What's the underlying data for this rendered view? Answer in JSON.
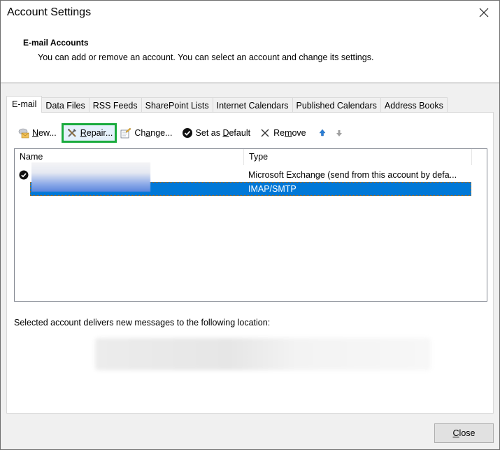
{
  "window": {
    "title": "Account Settings",
    "close_icon": "close-icon"
  },
  "header": {
    "section_title": "E-mail Accounts",
    "description": "You can add or remove an account. You can select an account and change its settings."
  },
  "tabs": [
    {
      "label": "E-mail",
      "active": true
    },
    {
      "label": "Data Files",
      "active": false
    },
    {
      "label": "RSS Feeds",
      "active": false
    },
    {
      "label": "SharePoint Lists",
      "active": false
    },
    {
      "label": "Internet Calendars",
      "active": false
    },
    {
      "label": "Published Calendars",
      "active": false
    },
    {
      "label": "Address Books",
      "active": false
    }
  ],
  "toolbar": {
    "new": {
      "pre": "",
      "accel": "N",
      "post": "ew...",
      "icon": "new-mail-icon"
    },
    "repair": {
      "pre": "",
      "accel": "R",
      "post": "epair...",
      "icon": "repair-tools-icon",
      "highlight_color": "#1aab3d"
    },
    "change": {
      "pre": "Ch",
      "accel": "a",
      "post": "nge...",
      "icon": "change-settings-icon"
    },
    "set_default": {
      "pre": "Set as ",
      "accel": "D",
      "post": "efault",
      "icon": "check-circle-icon"
    },
    "remove": {
      "pre": "Re",
      "accel": "m",
      "post": "ove",
      "icon": "x-icon"
    },
    "move_up_icon": "arrow-up-icon",
    "move_down_icon": "arrow-down-icon"
  },
  "accounts": {
    "columns": [
      "Name",
      "Type"
    ],
    "rows": [
      {
        "name": "",
        "type": "Microsoft Exchange (send from this account by defa...",
        "default": true,
        "selected": false
      },
      {
        "name": "",
        "type": "IMAP/SMTP",
        "default": false,
        "selected": true
      }
    ]
  },
  "delivery": {
    "label": "Selected account delivers new messages to the following location:",
    "location": ""
  },
  "footer": {
    "close": {
      "accel": "C",
      "post": "lose"
    }
  },
  "colors": {
    "selection": "#0078d7",
    "highlight_box": "#1aab3d"
  }
}
